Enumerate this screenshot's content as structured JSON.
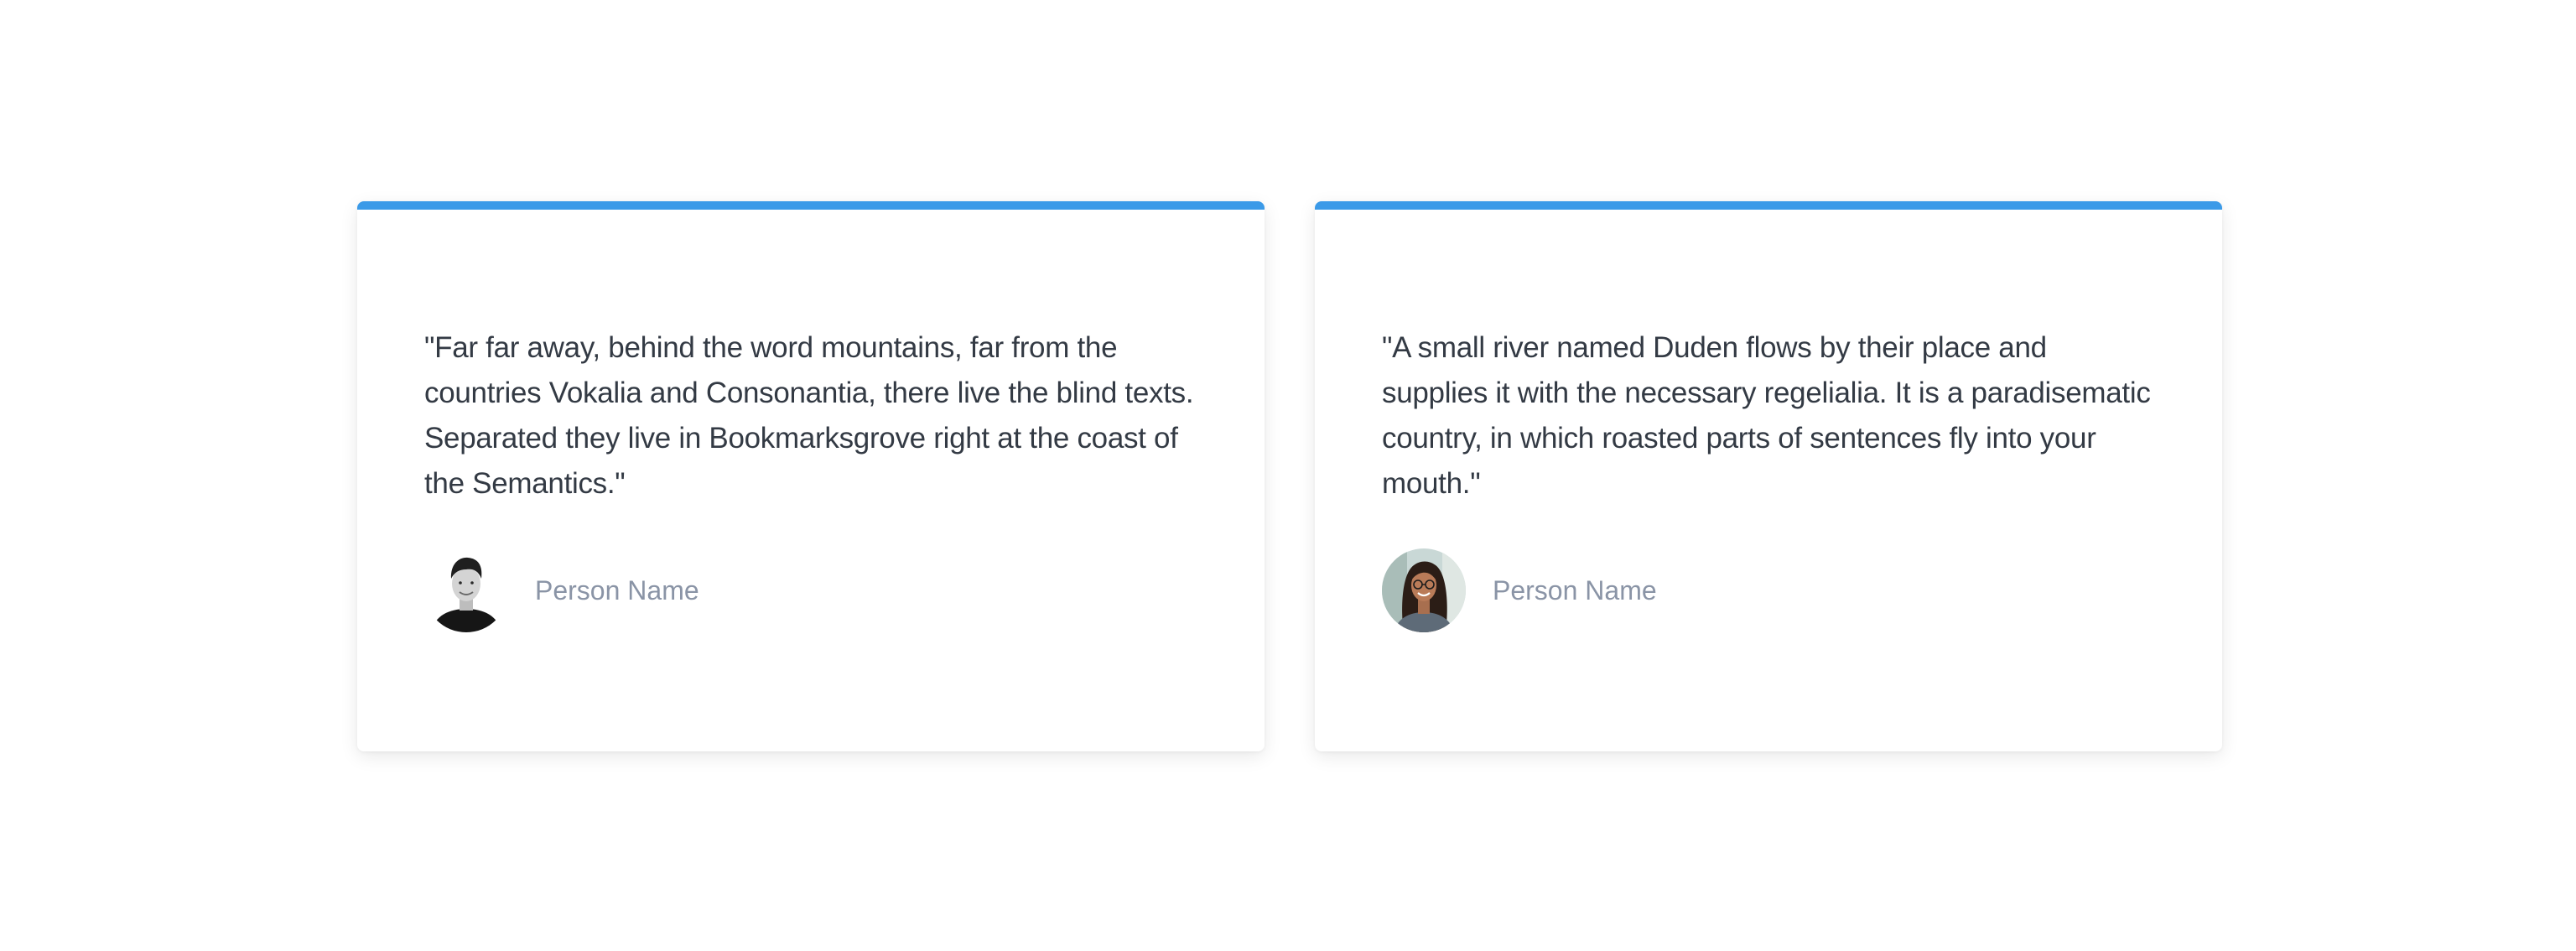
{
  "testimonials": [
    {
      "quote": "\"Far far away, behind the word mountains, far from the countries Vokalia and Consonantia, there live the blind texts. Separated they live in Bookmarksgrove right at the coast of the Semantics.\"",
      "person_name": "Person Name",
      "avatar": "man-portrait-grayscale"
    },
    {
      "quote": "\"A small river named Duden flows by their place and supplies it with the necessary regelialia. It is a paradisematic country, in which roasted parts of sentences fly into your mouth.\"",
      "person_name": "Person Name",
      "avatar": "woman-portrait-color"
    }
  ],
  "colors": {
    "accent": "#3b9ae8",
    "quote_text": "#333a44",
    "name_text": "#8a94a6"
  }
}
